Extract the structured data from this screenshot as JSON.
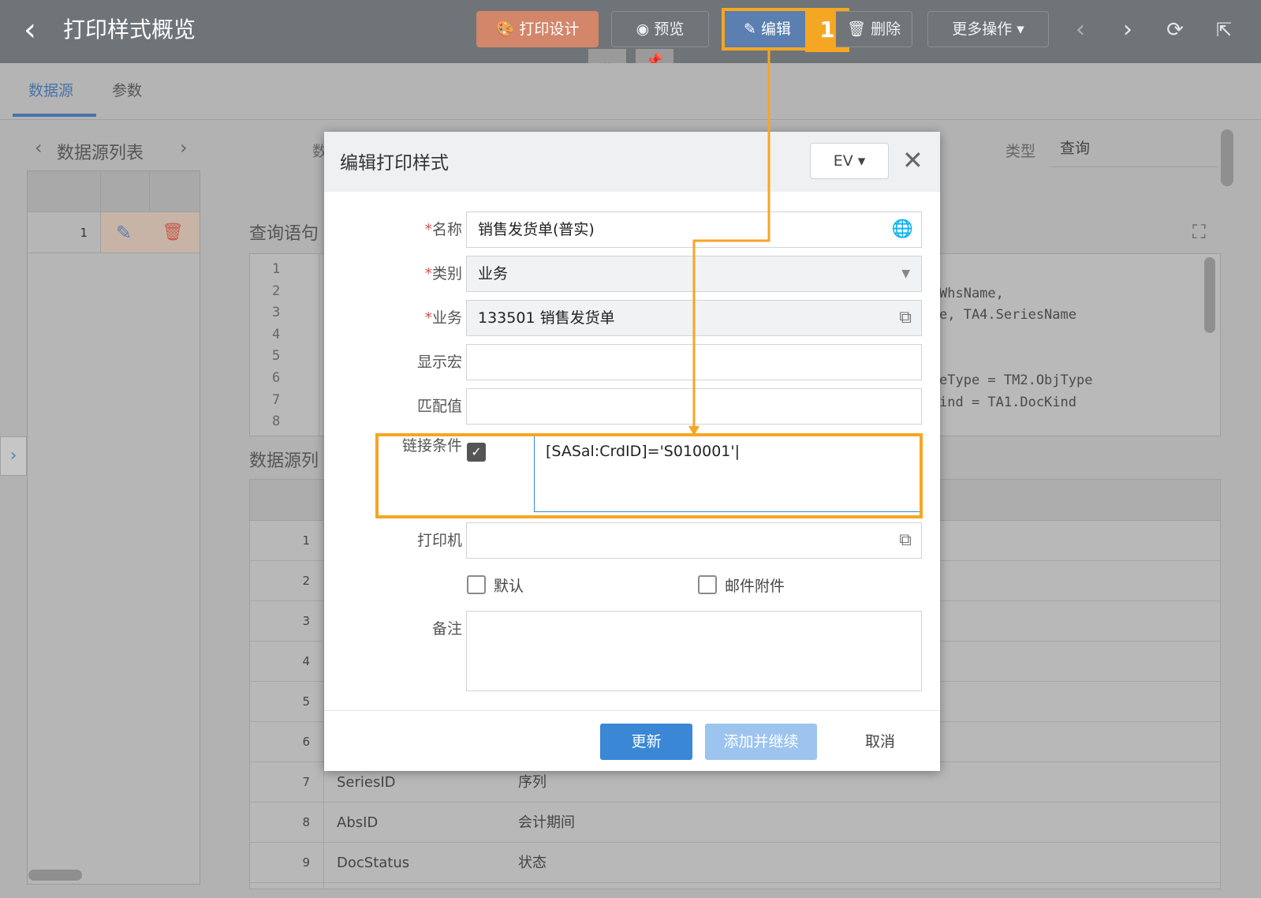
{
  "header": {
    "back_glyph": "‹",
    "title": "打印样式概览",
    "print_design": "打印设计",
    "preview": "预览",
    "edit": "编辑",
    "callout_number": "1",
    "delete": "删除",
    "more": "更多操作"
  },
  "tabs": [
    "数据源",
    "参数"
  ],
  "left_panel": {
    "title": "数据源列表",
    "row_number": "1"
  },
  "type_field": {
    "label": "类型",
    "value": "查询"
  },
  "query_section": {
    "label": "查询语句"
  },
  "code": {
    "line_numbers": [
      "1",
      "2",
      "3",
      "4",
      "5",
      "6",
      "7",
      "8"
    ],
    "fragments": [
      "WhsName,",
      "e, TA4.SeriesName",
      "eType = TM2.ObjType",
      "ind = TA1.DocKind"
    ]
  },
  "datasource_section": {
    "label": "数据源列"
  },
  "table_rows": [
    {
      "n": "1",
      "field": "",
      "desc": ""
    },
    {
      "n": "2",
      "field": "",
      "desc": ""
    },
    {
      "n": "3",
      "field": "",
      "desc": ""
    },
    {
      "n": "4",
      "field": "",
      "desc": ""
    },
    {
      "n": "5",
      "field": "",
      "desc": ""
    },
    {
      "n": "6",
      "field": "",
      "desc": ""
    },
    {
      "n": "7",
      "field": "SeriesID",
      "desc": "序列"
    },
    {
      "n": "8",
      "field": "AbsID",
      "desc": "会计期间"
    },
    {
      "n": "9",
      "field": "DocStatus",
      "desc": "状态"
    }
  ],
  "modal": {
    "title": "编辑打印样式",
    "lang": "EV",
    "fields": {
      "name_label": "名称",
      "name_value": "销售发货单(普实)",
      "category_label": "类别",
      "category_value": "业务",
      "business_label": "业务",
      "business_value": "133501 销售发货单",
      "display_macro_label": "显示宏",
      "display_macro_value": "",
      "match_label": "匹配值",
      "match_value": "",
      "link_label": "链接条件",
      "link_value": "[SASal:CrdID]='S010001'",
      "printer_label": "打印机",
      "printer_value": "",
      "default_label": "默认",
      "mail_label": "邮件附件",
      "remark_label": "备注",
      "remark_value": ""
    },
    "required_mark": "*",
    "buttons": {
      "update": "更新",
      "add_continue": "添加并继续",
      "cancel": "取消"
    }
  },
  "colors": {
    "accent": "#3a87d6",
    "highlight": "#f5a623",
    "orange_button": "#d3866a"
  }
}
